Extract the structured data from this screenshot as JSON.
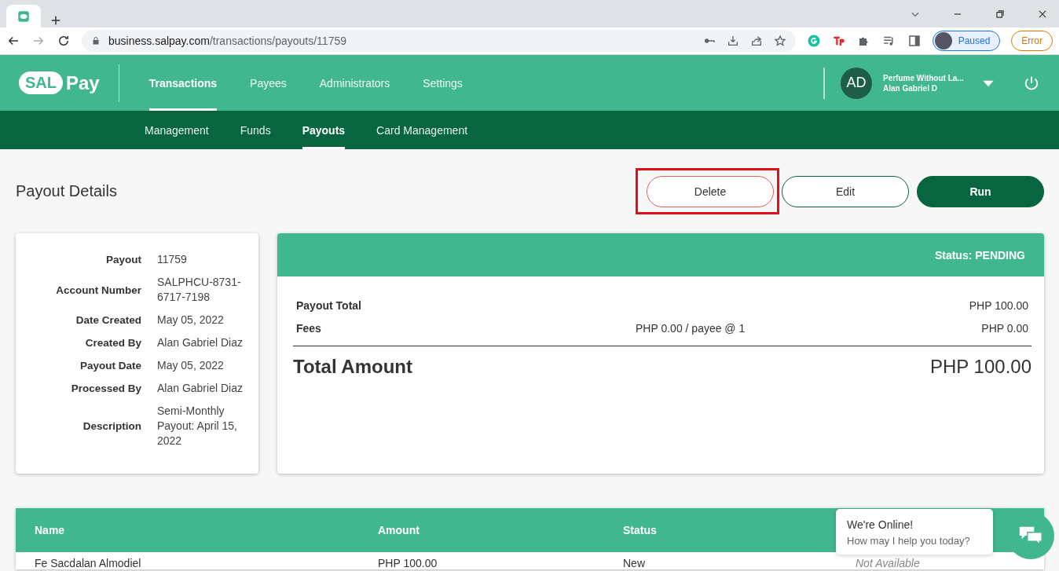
{
  "browser": {
    "address_domain": "business.salpay.com",
    "address_path": "/transactions/payouts/11759",
    "profile_label": "Paused",
    "error_label": "Error"
  },
  "header": {
    "logo_left": "SAL",
    "logo_right": "Pay",
    "nav": [
      {
        "label": "Transactions",
        "selected": true
      },
      {
        "label": "Payees",
        "selected": false
      },
      {
        "label": "Administrators",
        "selected": false
      },
      {
        "label": "Settings",
        "selected": false
      }
    ],
    "user": {
      "initials": "AD",
      "company": "Perfume Without La...",
      "name": "Alan Gabriel D"
    }
  },
  "subnav": [
    {
      "label": "Management",
      "selected": false
    },
    {
      "label": "Funds",
      "selected": false
    },
    {
      "label": "Payouts",
      "selected": true
    },
    {
      "label": "Card Management",
      "selected": false
    }
  ],
  "page_title": "Payout Details",
  "actions": [
    {
      "label": "Delete",
      "kind": "danger",
      "highlighted": true
    },
    {
      "label": "Edit",
      "kind": "outline",
      "highlighted": false
    },
    {
      "label": "Run",
      "kind": "primary",
      "highlighted": false
    }
  ],
  "details": [
    {
      "label": "Payout",
      "value": "11759"
    },
    {
      "label": "Account Number",
      "value": "SALPHCU-8731-6717-7198"
    },
    {
      "label": "Date Created",
      "value": "May 05, 2022"
    },
    {
      "label": "Created By",
      "value": "Alan Gabriel Diaz"
    },
    {
      "label": "Payout Date",
      "value": "May 05, 2022"
    },
    {
      "label": "Processed By",
      "value": "Alan Gabriel Diaz"
    },
    {
      "label": "Description",
      "value": "Semi-Monthly Payout: April 15, 2022"
    }
  ],
  "summary": {
    "status": "Status: PENDING",
    "lines": [
      {
        "label": "Payout Total",
        "amount": "PHP 100.00"
      },
      {
        "label": "Fees",
        "note": "PHP 0.00 / payee @ 1",
        "amount": "PHP 0.00"
      }
    ],
    "total_label": "Total Amount",
    "total_amount": "PHP 100.00"
  },
  "table": {
    "columns": [
      "Name",
      "Amount",
      "Status"
    ],
    "rows": [
      {
        "cells": [
          {
            "text": "Fe Sacdalan Almodiel",
            "muted": false
          },
          {
            "text": "PHP 100.00",
            "muted": false
          },
          {
            "text": "New",
            "muted": false
          },
          {
            "text": "Not Available",
            "muted": true
          }
        ]
      }
    ]
  },
  "chat": {
    "title": "We're Online!",
    "subtitle": "How may I help you today?"
  }
}
